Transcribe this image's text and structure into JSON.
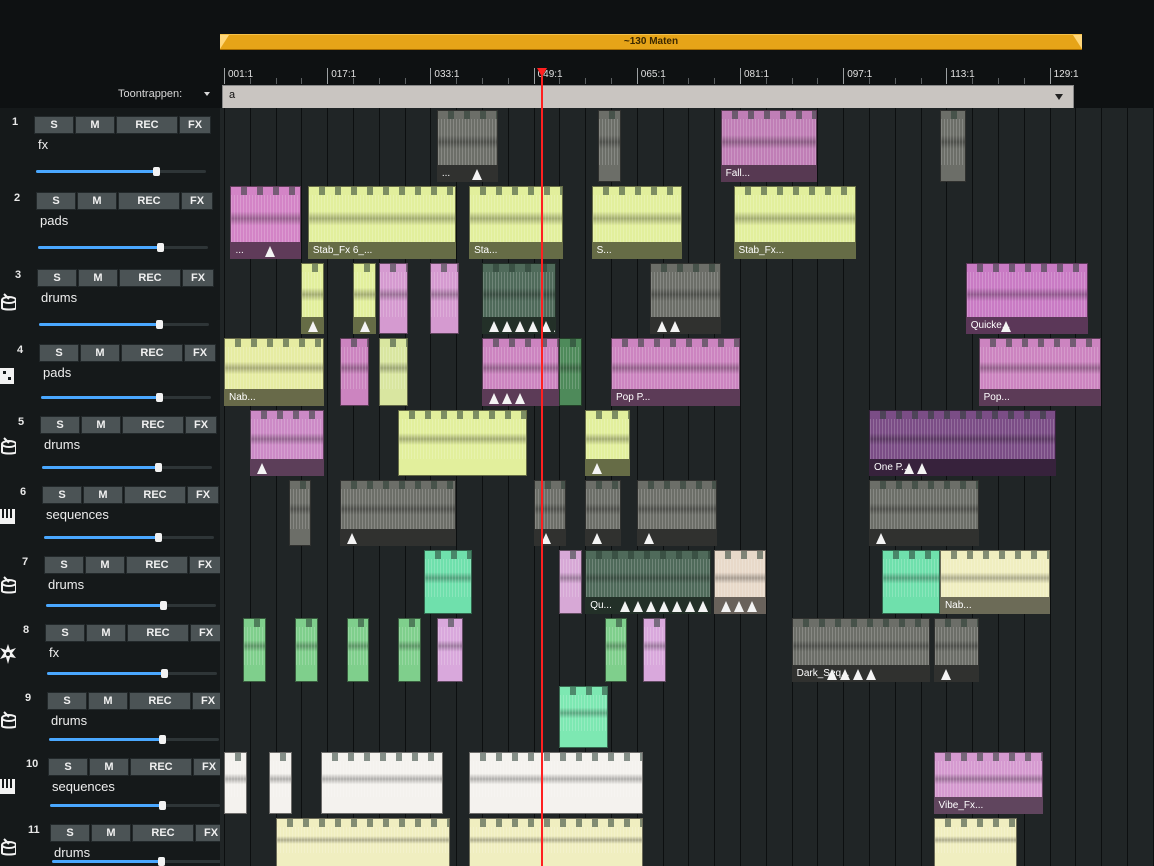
{
  "timeline": {
    "length_label": "~130 Maten",
    "ruler": [
      "001:1",
      "017:1",
      "033:1",
      "049:1",
      "065:1",
      "081:1",
      "097:1",
      "113:1",
      "129:1"
    ],
    "scale_label": "Toontrappen:",
    "scale_value": "a"
  },
  "track_button_labels": {
    "solo": "S",
    "mute": "M",
    "record": "REC",
    "effects": "FX"
  },
  "colors": {
    "accent": "#e6a418",
    "playhead": "#ff2020",
    "volume": "#4aa8ff"
  },
  "tracks": [
    {
      "number": "1",
      "name": "fx",
      "icon": "fx-icon",
      "volume": 0.88,
      "clips": [
        {
          "start": 33,
          "len": 9.5,
          "color": "#6c6e68",
          "name": "...",
          "markers": 1
        },
        {
          "start": 58,
          "len": 3.5,
          "color": "#6c6e68",
          "name": "",
          "markers": 0
        },
        {
          "start": 77,
          "len": 15,
          "color": "#c07eb6",
          "name": "Fall...",
          "markers": 0
        },
        {
          "start": 111,
          "len": 4,
          "color": "#6c6e68",
          "name": "",
          "markers": 0
        }
      ]
    },
    {
      "number": "2",
      "name": "pads",
      "icon": "synth-icon",
      "volume": 0.9,
      "clips": [
        {
          "start": 1,
          "len": 11,
          "color": "#d384c6",
          "name": "...",
          "markers": 1
        },
        {
          "start": 13,
          "len": 23,
          "color": "#e2ef9c",
          "name": "Stab_Fx 6_...",
          "markers": 0
        },
        {
          "start": 38,
          "len": 14.5,
          "color": "#e2ef9c",
          "name": "Sta...",
          "markers": 0
        },
        {
          "start": 57,
          "len": 14,
          "color": "#e2ef9c",
          "name": "S...",
          "markers": 0
        },
        {
          "start": 79,
          "len": 19,
          "color": "#e2ef9c",
          "name": "Stab_Fx...",
          "markers": 0
        }
      ]
    },
    {
      "number": "3",
      "name": "drums",
      "icon": "drum-icon",
      "volume": 0.88,
      "clips": [
        {
          "start": 12,
          "len": 3.5,
          "color": "#e2ef9c",
          "name": "",
          "markers": 1
        },
        {
          "start": 20,
          "len": 3.5,
          "color": "#e2ef9c",
          "name": "",
          "markers": 1
        },
        {
          "start": 24,
          "len": 4.5,
          "color": "#d59ad0",
          "name": "",
          "markers": 0
        },
        {
          "start": 32,
          "len": 4.5,
          "color": "#d59ad0",
          "name": "",
          "markers": 0
        },
        {
          "start": 40,
          "len": 11.5,
          "color": "#4f6a5a",
          "name": "",
          "markers": 6
        },
        {
          "start": 66,
          "len": 11,
          "color": "#6c6e68",
          "name": "",
          "markers": 2
        },
        {
          "start": 115,
          "len": 19,
          "color": "#c97bc4",
          "name": "Quicke...",
          "markers": 1
        }
      ]
    },
    {
      "number": "4",
      "name": "pads",
      "icon": "synth-icon",
      "volume": 0.87,
      "clips": [
        {
          "start": 0,
          "len": 15.5,
          "color": "#e6eca2",
          "name": "Nab...",
          "markers": 0
        },
        {
          "start": 18,
          "len": 4.5,
          "color": "#cc84c0",
          "name": "",
          "markers": 0
        },
        {
          "start": 24,
          "len": 4.5,
          "color": "#d9e6a0",
          "name": "",
          "markers": 0
        },
        {
          "start": 40,
          "len": 12,
          "color": "#cc84c0",
          "name": "",
          "markers": 3
        },
        {
          "start": 52,
          "len": 3.5,
          "color": "#4e8a5a",
          "name": "",
          "markers": 0
        },
        {
          "start": 60,
          "len": 20,
          "color": "#cc84c0",
          "name": "Pop P...",
          "markers": 0
        },
        {
          "start": 117,
          "len": 19,
          "color": "#cc84c0",
          "name": "Pop...",
          "markers": 0
        }
      ]
    },
    {
      "number": "5",
      "name": "drums",
      "icon": "drum-icon",
      "volume": 0.85,
      "clips": [
        {
          "start": 4,
          "len": 11.5,
          "color": "#cc8ac6",
          "name": "",
          "markers": 1
        },
        {
          "start": 27,
          "len": 20,
          "color": "#e2ef9c",
          "name": "",
          "markers": 0
        },
        {
          "start": 56,
          "len": 7,
          "color": "#e2ef9c",
          "name": "",
          "markers": 1
        },
        {
          "start": 100,
          "len": 29,
          "color": "#7b4d86",
          "name": "One P...",
          "markers": 2
        }
      ]
    },
    {
      "number": "6",
      "name": "sequences",
      "icon": "keyboard-icon",
      "volume": 0.84,
      "clips": [
        {
          "start": 10,
          "len": 3.5,
          "color": "#6c6e68",
          "name": "",
          "markers": 0
        },
        {
          "start": 18,
          "len": 18,
          "color": "#6c6e68",
          "name": "",
          "markers": 1
        },
        {
          "start": 48,
          "len": 5,
          "color": "#6c6e68",
          "name": "",
          "markers": 1
        },
        {
          "start": 56,
          "len": 5.5,
          "color": "#6c6e68",
          "name": "",
          "markers": 1
        },
        {
          "start": 64,
          "len": 12.5,
          "color": "#6c6e68",
          "name": "",
          "markers": 1
        },
        {
          "start": 100,
          "len": 17,
          "color": "#6c6e68",
          "name": "",
          "markers": 1
        }
      ]
    },
    {
      "number": "7",
      "name": "drums",
      "icon": "drum-icon",
      "volume": 0.86,
      "clips": [
        {
          "start": 31,
          "len": 7.5,
          "color": "#6fe0ac",
          "name": "",
          "markers": 0
        },
        {
          "start": 52,
          "len": 3.5,
          "color": "#d7a8d6",
          "name": "",
          "markers": 0
        },
        {
          "start": 56,
          "len": 19.5,
          "color": "#4f6a5a",
          "name": "Qu...",
          "markers": 8
        },
        {
          "start": 76,
          "len": 8,
          "color": "#e8d9c9",
          "name": "",
          "markers": 3
        },
        {
          "start": 102,
          "len": 9,
          "color": "#6fe0ac",
          "name": "",
          "markers": 0
        },
        {
          "start": 111,
          "len": 17,
          "color": "#f0eec0",
          "name": "Nab...",
          "markers": 0
        }
      ]
    },
    {
      "number": "8",
      "name": "fx",
      "icon": "explosion-icon",
      "volume": 0.86,
      "clips": [
        {
          "start": 3,
          "len": 3.5,
          "color": "#7fcf8c",
          "name": "",
          "markers": 0
        },
        {
          "start": 11,
          "len": 3.5,
          "color": "#7fcf8c",
          "name": "",
          "markers": 0
        },
        {
          "start": 19,
          "len": 3.5,
          "color": "#7fcf8c",
          "name": "",
          "markers": 0
        },
        {
          "start": 27,
          "len": 3.5,
          "color": "#7fcf8c",
          "name": "",
          "markers": 0
        },
        {
          "start": 33,
          "len": 4,
          "color": "#d9a8dc",
          "name": "",
          "markers": 0
        },
        {
          "start": 59,
          "len": 3.5,
          "color": "#7fcf8c",
          "name": "",
          "markers": 0
        },
        {
          "start": 65,
          "len": 3.5,
          "color": "#d9a8dc",
          "name": "",
          "markers": 0
        },
        {
          "start": 88,
          "len": 21.5,
          "color": "#6c6e68",
          "name": "Dark_Seq...",
          "markers": 4
        },
        {
          "start": 110,
          "len": 7,
          "color": "#6c6e68",
          "name": "",
          "markers": 1
        }
      ]
    },
    {
      "number": "9",
      "name": "drums",
      "icon": "drum-icon",
      "volume": 0.83,
      "clips": [
        {
          "start": 52,
          "len": 7.5,
          "color": "#7de8b2",
          "name": "",
          "markers": 0
        }
      ]
    },
    {
      "number": "10",
      "name": "sequences",
      "icon": "keyboard-icon",
      "volume": 0.82,
      "clips": [
        {
          "start": 0,
          "len": 3.5,
          "color": "#f4f2ee",
          "name": "",
          "markers": 0
        },
        {
          "start": 7,
          "len": 3.5,
          "color": "#f4f2ee",
          "name": "",
          "markers": 0
        },
        {
          "start": 15,
          "len": 19,
          "color": "#f4f2ee",
          "name": "",
          "markers": 0
        },
        {
          "start": 38,
          "len": 27,
          "color": "#f4f2ee",
          "name": "",
          "markers": 0
        },
        {
          "start": 110,
          "len": 17,
          "color": "#d59ad0",
          "name": "Vibe_Fx...",
          "markers": 0
        }
      ]
    },
    {
      "number": "11",
      "name": "drums",
      "icon": "drum-icon",
      "volume": 0.8,
      "clips": [
        {
          "start": 8,
          "len": 27,
          "color": "#f0eec0",
          "name": "",
          "markers": 0
        },
        {
          "start": 38,
          "len": 27,
          "color": "#f0eec0",
          "name": "",
          "markers": 0
        },
        {
          "start": 110,
          "len": 13,
          "color": "#f0eec0",
          "name": "",
          "markers": 0
        }
      ]
    }
  ]
}
